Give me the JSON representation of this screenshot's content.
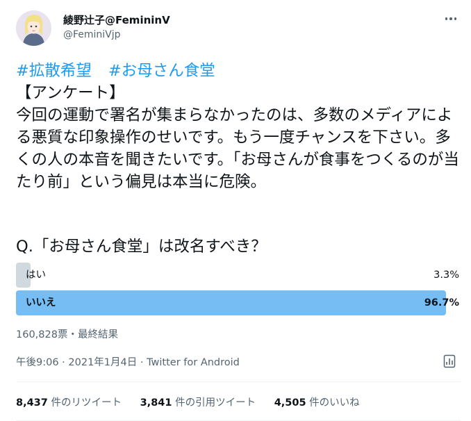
{
  "author": {
    "display_name": "綾野辻子@FemininV",
    "handle": "@FeminiVjp"
  },
  "tweet": {
    "hashtags": [
      "#拡散希望",
      "#お母さん食堂"
    ],
    "heading": "【アンケート】",
    "paragraph": "今回の運動で署名が集まらなかったのは、多数のメディアによる悪質な印象操作のせいです。もう一度チャンスを下さい。多くの人の本音を聞きたいです。「お母さんが食事をつくるのが当たり前」という偏見は本当に危険。",
    "question": "Q.「お母さん食堂」は改名すべき？"
  },
  "poll": {
    "options": [
      {
        "label": "はい",
        "percent_text": "3.3%",
        "percent": 3.3
      },
      {
        "label": "いいえ",
        "percent_text": "96.7%",
        "percent": 96.7
      }
    ],
    "summary": "160,828票・最終結果"
  },
  "timestamp": "午後9:06 · 2021年1月4日 · Twitter for Android",
  "stats": [
    {
      "count": "8,437",
      "label": "件のリツイート"
    },
    {
      "count": "3,841",
      "label": "件の引用ツイート"
    },
    {
      "count": "4,505",
      "label": "件のいいね"
    }
  ],
  "colors": {
    "link": "#1d9bf0",
    "poll_winner": "#76bdf4",
    "poll_other": "#cfd9de",
    "secondary_text": "#536471"
  },
  "icons": {
    "more": "more-horizontal-icon",
    "analytics": "analytics-icon"
  }
}
